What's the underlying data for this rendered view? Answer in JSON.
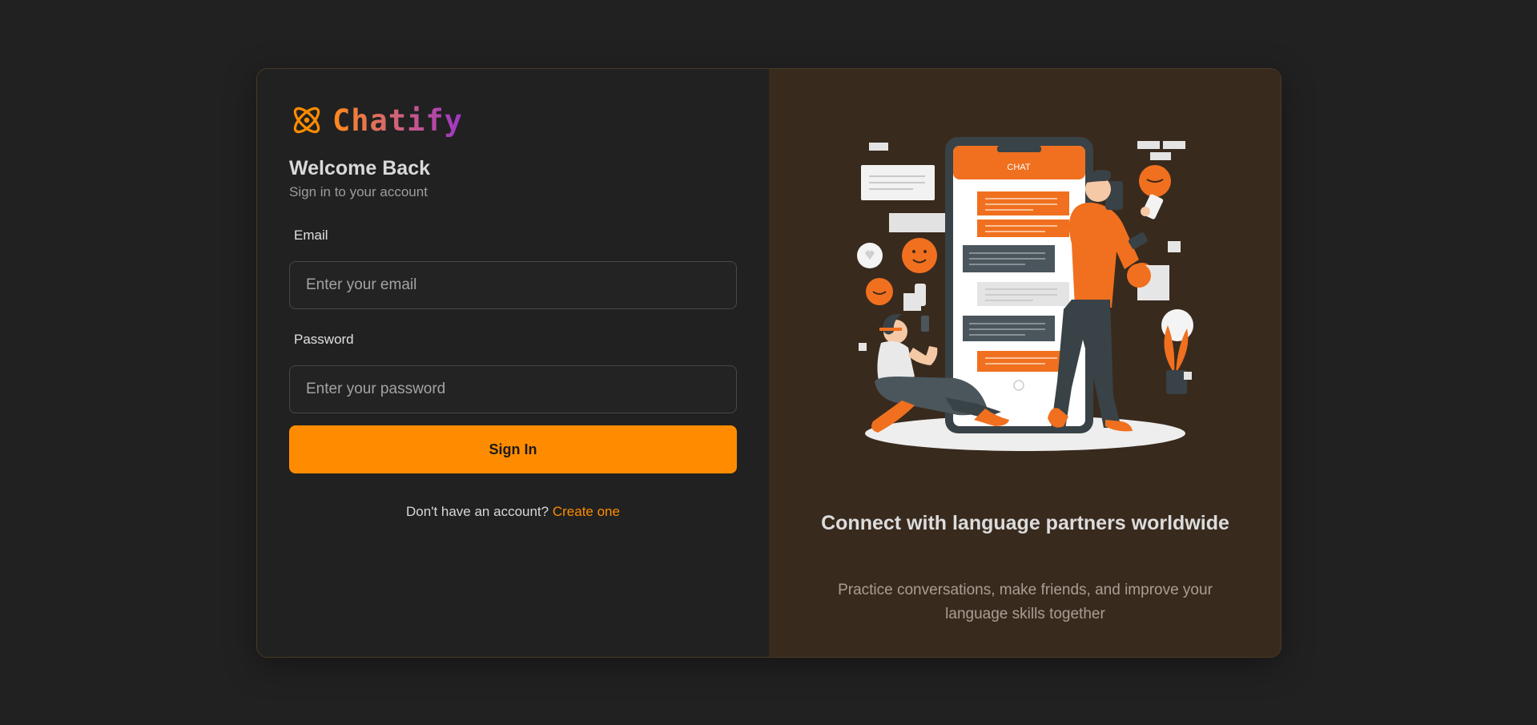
{
  "brand": {
    "name": "Chatify",
    "icon": "atom-icon",
    "gradient": [
      "#ff8a1a",
      "#d1627a",
      "#9b35c8"
    ]
  },
  "form": {
    "title": "Welcome Back",
    "subtitle": "Sign in to your account",
    "email_label": "Email",
    "email_placeholder": "Enter your email",
    "email_value": "",
    "password_label": "Password",
    "password_placeholder": "Enter your password",
    "password_value": "",
    "submit_label": "Sign In",
    "signup_prompt": "Don't have an account?",
    "signup_link": "Create one"
  },
  "promo": {
    "illustration": "chat-app-people-illustration",
    "chat_header": "CHAT",
    "title": "Connect with language partners worldwide",
    "description": "Practice conversations, make friends, and improve your language skills together"
  },
  "colors": {
    "accent": "#ff8c00",
    "background": "#212121",
    "panel": "#392a1e"
  }
}
